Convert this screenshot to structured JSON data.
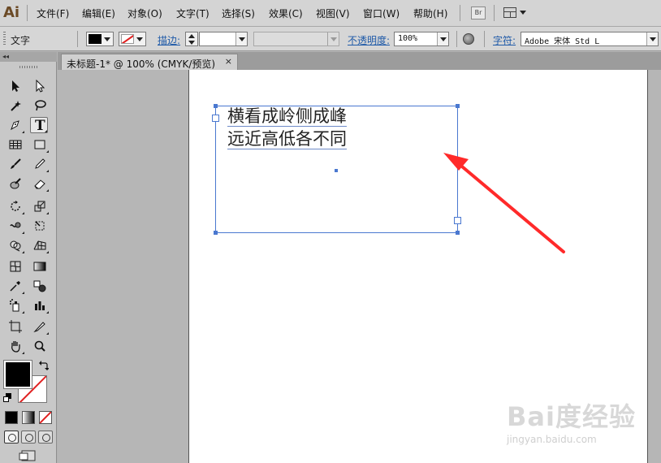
{
  "app": {
    "logo_text": "Ai",
    "menu": [
      "文件(F)",
      "编辑(E)",
      "对象(O)",
      "文字(T)",
      "选择(S)",
      "效果(C)",
      "视图(V)",
      "窗口(W)",
      "帮助(H)"
    ],
    "bridge_button": "Br"
  },
  "control_bar": {
    "mode_label": "文字",
    "fill_color": "#000000",
    "stroke_color": "none",
    "stroke_label": "描边:",
    "stroke_weight": "",
    "opacity_label": "不透明度:",
    "opacity_value": "100%",
    "character_label": "字符:",
    "font_name": "Adobe 宋体 Std L"
  },
  "document": {
    "tab_title": "未标题-1* @ 100% (CMYK/预览)",
    "tab_close": "×",
    "text_lines": [
      "横看成岭侧成峰",
      "远近高低各不同"
    ]
  },
  "tools": {
    "active_tool": "type-tool",
    "fill_color": "#000000",
    "stroke_color": "none",
    "list": [
      "selection",
      "direct-selection",
      "magic-wand",
      "lasso",
      "pen",
      "type",
      "line-segment",
      "rectangle",
      "paintbrush",
      "pencil",
      "blob-brush",
      "eraser",
      "rotate",
      "scale",
      "warp",
      "free-transform",
      "shape-builder",
      "perspective-grid",
      "mesh",
      "gradient",
      "eyedropper",
      "blend",
      "symbol-sprayer",
      "column-graph",
      "artboard",
      "slice",
      "hand",
      "zoom"
    ]
  },
  "annotation": {
    "arrow_color": "#ff2a2a"
  },
  "watermark": {
    "logo": "Bai度经验",
    "url": "jingyan.baidu.com"
  },
  "colors": {
    "selection_blue": "#4a78d0",
    "link_blue": "#1f5aa8"
  }
}
